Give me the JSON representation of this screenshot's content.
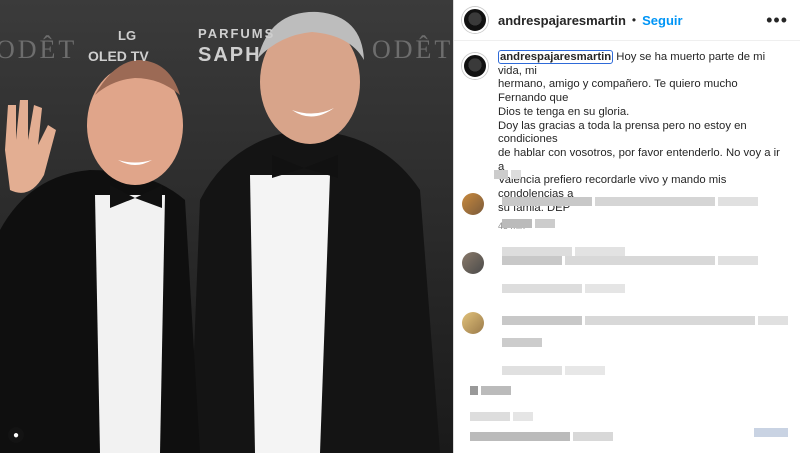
{
  "post": {
    "username": "andrespajaresmartin",
    "follow_label": "Seguir",
    "more_label": "•••",
    "caption_lines": [
      "Hoy se ha muerto parte de mi vida, mi",
      "hermano, amigo y compañero. Te quiero mucho Fernando que",
      "Dios te tenga en su gloria.",
      "Doy las gracias a toda la prensa pero no estoy en condiciones",
      "de hablar con vosotros, por favor entenderlo. No voy a ir a",
      "Valencia prefiero recordarle vivo y mando mis condolencias a",
      "su famia. DEP"
    ],
    "timestamp": "45 min"
  },
  "photo": {
    "backdrop_texts": [
      "ODÊT",
      "LG",
      "OLED TV",
      "PARFUMS",
      "SAPH",
      "ODÊT"
    ],
    "badge_icon": "user-tag-icon"
  },
  "comments_note": "blurred",
  "colors": {
    "follow": "#0095f6",
    "text": "#262626",
    "muted": "#8e8e8e",
    "border": "#dbdbdb"
  }
}
